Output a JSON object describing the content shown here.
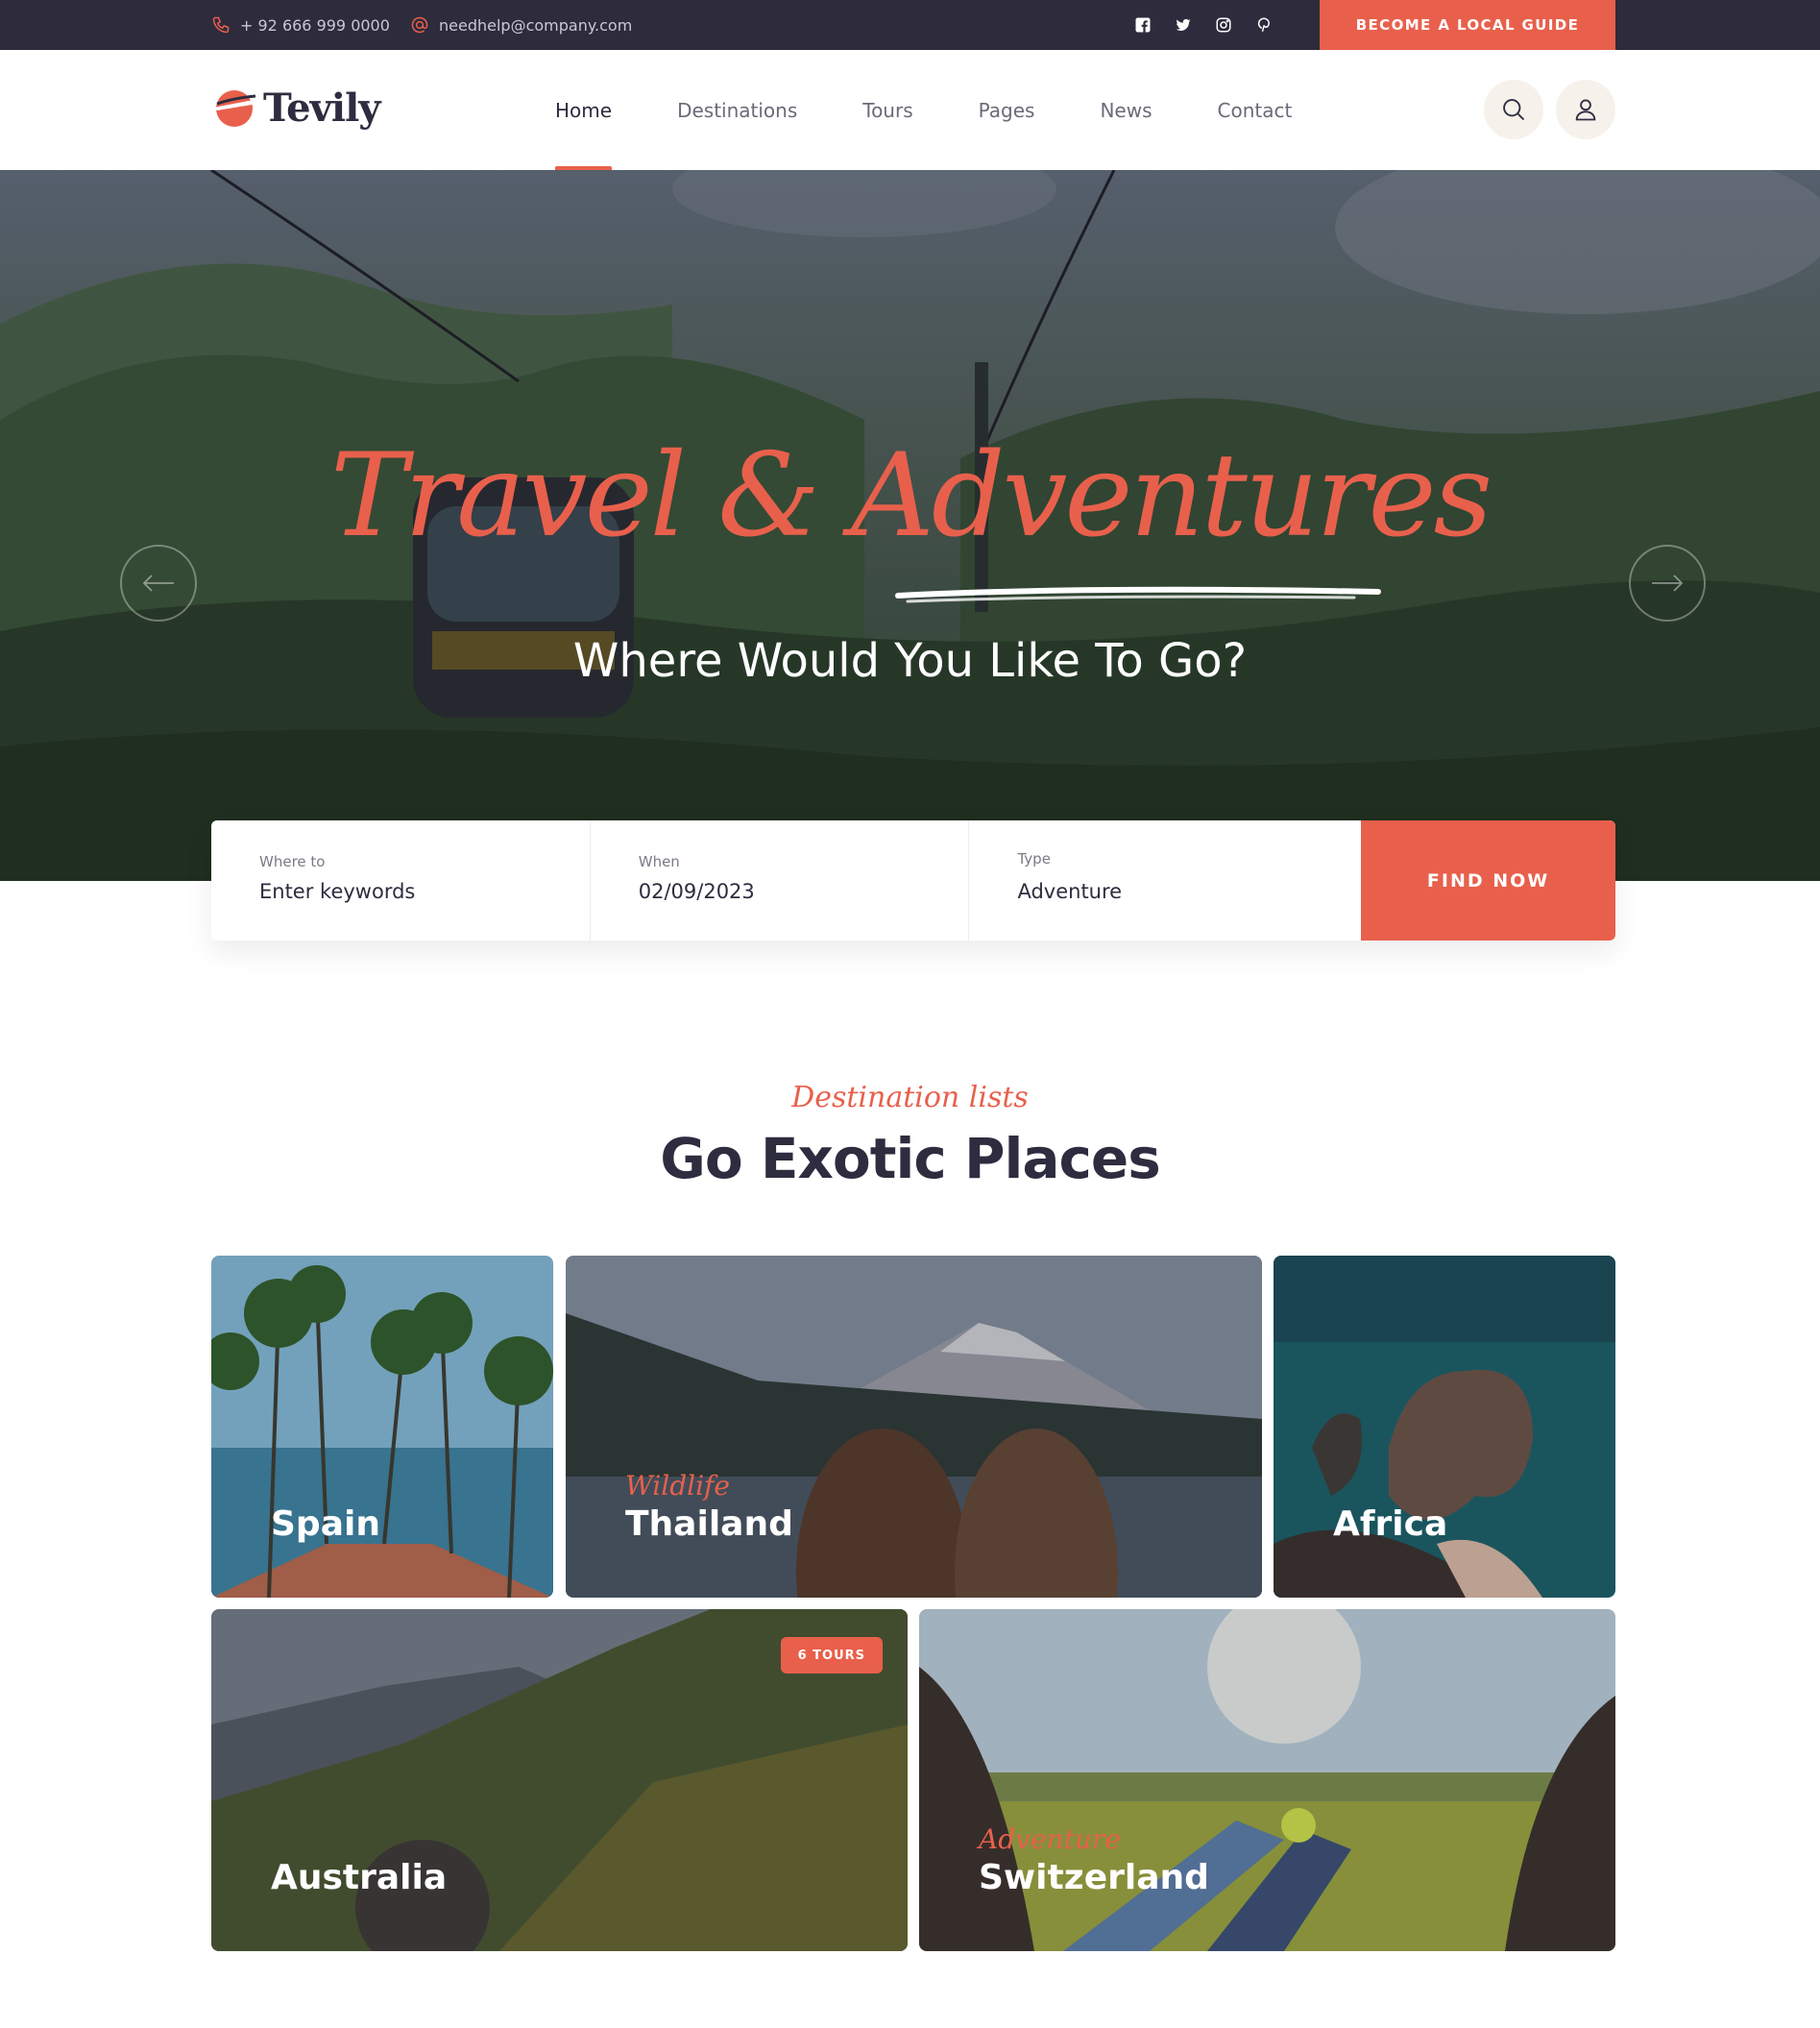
{
  "topbar": {
    "phone": "+ 92 666 999 0000",
    "email": "needhelp@company.com",
    "social": [
      "facebook-icon",
      "twitter-icon",
      "instagram-icon",
      "pinterest-icon"
    ],
    "cta": "BECOME A LOCAL GUIDE"
  },
  "header": {
    "logo": "Tevily",
    "nav": [
      "Home",
      "Destinations",
      "Tours",
      "Pages",
      "News",
      "Contact"
    ],
    "active_nav": "Home"
  },
  "hero": {
    "script_title": "Travel & Adventures",
    "subtitle": "Where Would You Like To Go?"
  },
  "search": {
    "where_label": "Where to",
    "where_placeholder": "Enter keywords",
    "when_label": "When",
    "when_value": "02/09/2023",
    "type_label": "Type",
    "type_value": "Adventure",
    "submit": "FIND NOW"
  },
  "destinations": {
    "tagline": "Destination lists",
    "title": "Go Exotic Places",
    "cards": [
      {
        "name": "Spain",
        "sub": "",
        "badge": ""
      },
      {
        "name": "Thailand",
        "sub": "Wildlife",
        "badge": ""
      },
      {
        "name": "Africa",
        "sub": "",
        "badge": ""
      },
      {
        "name": "Australia",
        "sub": "",
        "badge": "6 TOURS"
      },
      {
        "name": "Switzerland",
        "sub": "Adventure",
        "badge": ""
      }
    ]
  },
  "colors": {
    "accent": "#e8604c",
    "dark": "#2d2b3c",
    "text": "#2e2c3f",
    "muted": "#6b6a78",
    "cream": "#f6f1ea"
  }
}
